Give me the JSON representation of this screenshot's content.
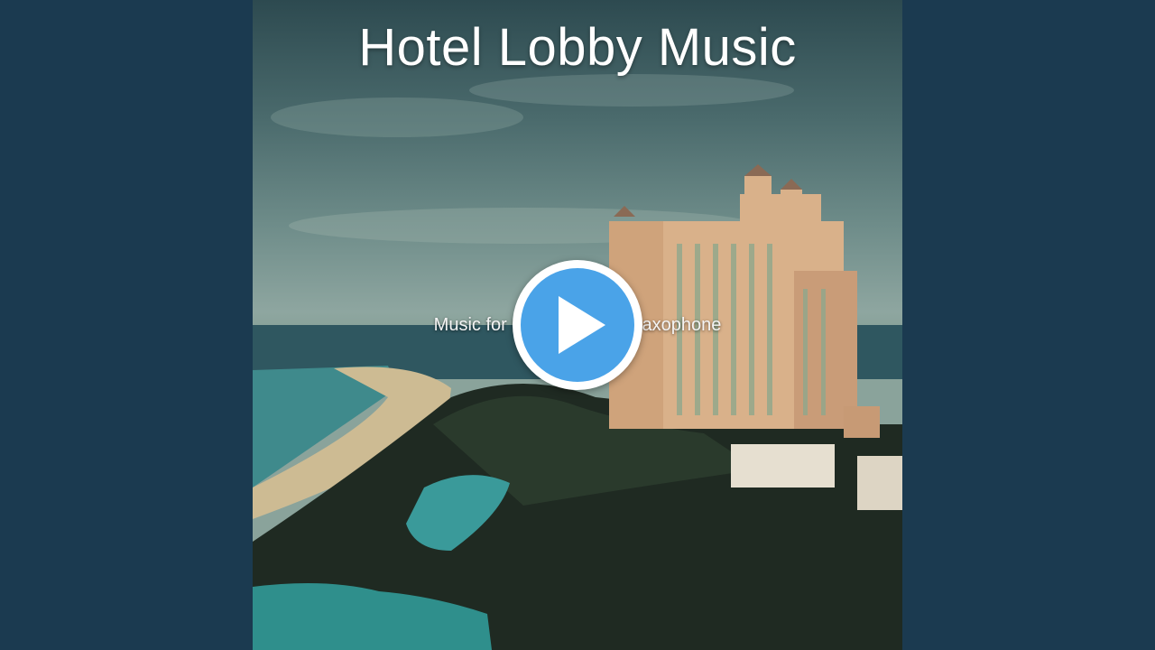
{
  "video": {
    "title": "Hotel Lobby Music",
    "subtitle": "Music for Easter - Tenor Saxophone",
    "play_icon": "play-icon",
    "colors": {
      "background": "#1b3a50",
      "play_button": "#4aa3e8",
      "play_button_ring": "#ffffff"
    }
  }
}
